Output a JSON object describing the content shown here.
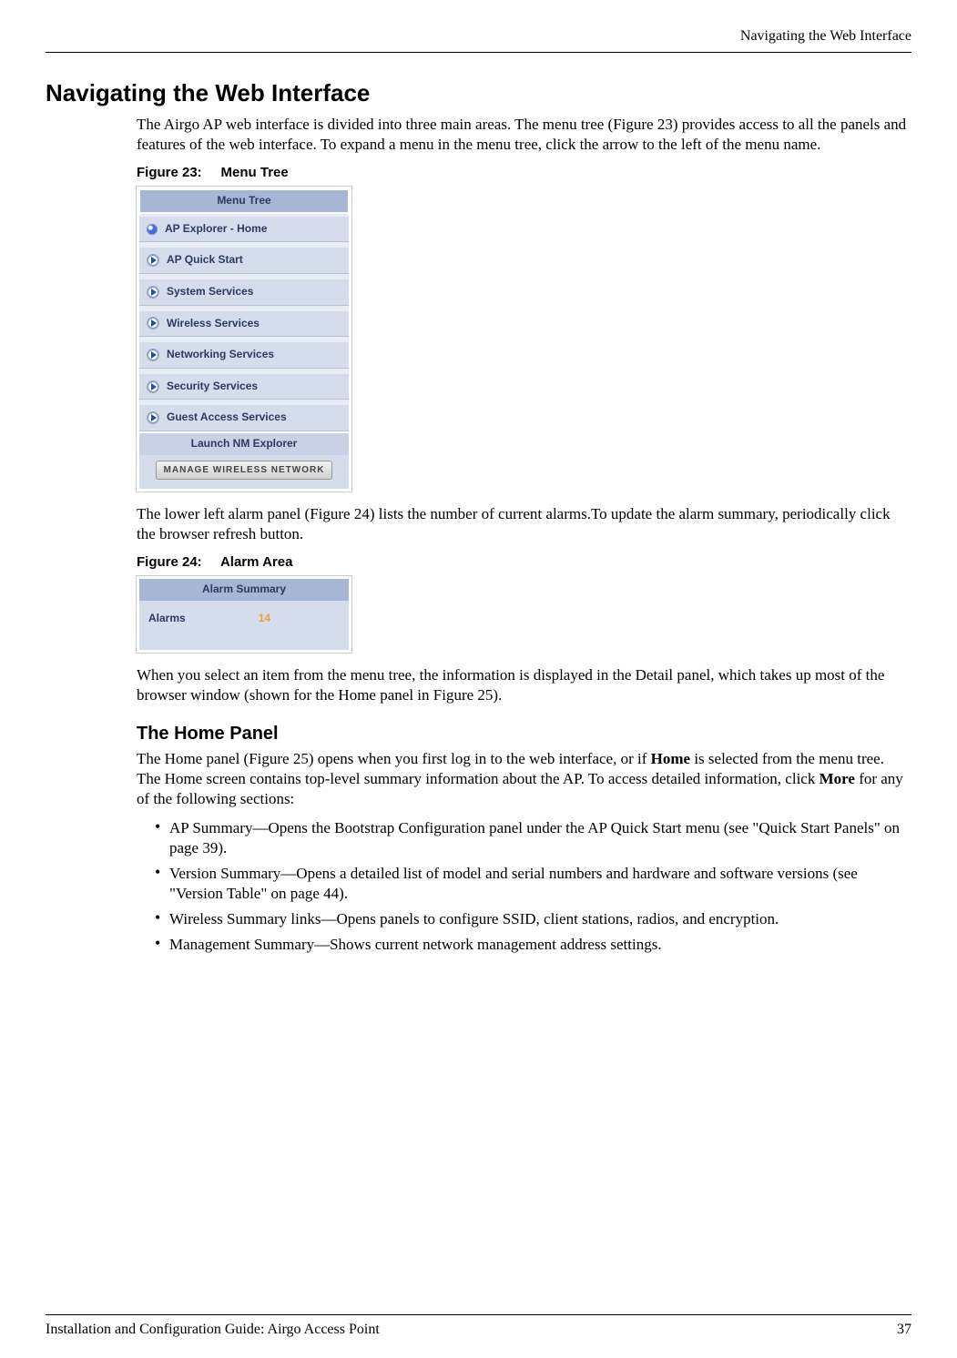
{
  "header": {
    "running_title": "Navigating the Web Interface"
  },
  "section": {
    "title": "Navigating the Web Interface",
    "intro": "The Airgo AP web interface is divided into three main areas. The menu tree (Figure 23) provides access to all the panels and features of the web interface. To expand a menu in the menu tree, click the arrow to the left of the menu name."
  },
  "figure23": {
    "caption_label": "Figure 23:",
    "caption_title": "Menu Tree",
    "header": "Menu Tree",
    "items": [
      "AP Explorer - Home",
      "AP Quick Start",
      "System Services",
      "Wireless Services",
      "Networking Services",
      "Security Services",
      "Guest Access Services"
    ],
    "launch_label": "Launch NM Explorer",
    "button_label": "MANAGE WIRELESS NETWORK"
  },
  "mid_text": "The lower left alarm panel (Figure 24) lists the number of current alarms.To update the alarm summary, periodically click the browser refresh button.",
  "figure24": {
    "caption_label": "Figure 24:",
    "caption_title": "Alarm Area",
    "header": "Alarm Summary",
    "label": "Alarms",
    "count": "14"
  },
  "after_alarm": "When you select an item from the menu tree, the information is displayed in the Detail panel, which takes up most of the browser window (shown for the Home panel in Figure 25).",
  "home_panel": {
    "title": "The Home Panel",
    "intro_1": "The Home panel (Figure 25) opens when you first log in to the web interface, or if ",
    "intro_bold1": "Home",
    "intro_2": " is selected from the menu tree. The Home screen contains top-level summary information about the AP. To access detailed information, click ",
    "intro_bold2": "More",
    "intro_3": " for any of the following sections:",
    "bullets": [
      "AP Summary—Opens the Bootstrap Configuration panel under the AP Quick Start menu (see \"Quick Start Panels\" on page 39).",
      "Version Summary—Opens a detailed list of model and serial numbers and hardware and software versions (see \"Version Table\" on page 44).",
      "Wireless Summary links—Opens panels to configure SSID, client stations, radios, and encryption.",
      "Management Summary—Shows current network management address settings."
    ]
  },
  "footer": {
    "left": "Installation and Configuration Guide: Airgo Access Point",
    "right": "37"
  }
}
